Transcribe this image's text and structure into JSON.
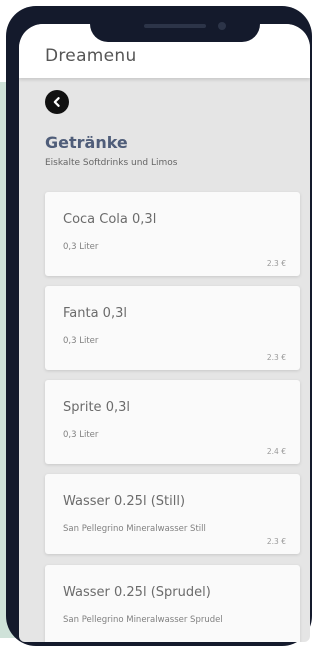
{
  "app": {
    "title": "Dreamenu"
  },
  "category": {
    "title": "Getränke",
    "subtitle": "Eiskalte Softdrinks und Limos"
  },
  "items": [
    {
      "name": "Coca Cola 0,3l",
      "description": "0,3 Liter",
      "price": "2.3 €"
    },
    {
      "name": "Fanta 0,3l",
      "description": "0,3 Liter",
      "price": "2.3 €"
    },
    {
      "name": "Sprite 0,3l",
      "description": "0,3 Liter",
      "price": "2.4 €"
    },
    {
      "name": "Wasser 0.25l (Still)",
      "description": "San Pellegrino Mineralwasser Still",
      "price": "2.3 €"
    },
    {
      "name": "Wasser 0.25l (Sprudel)",
      "description": "San Pellegrino Mineralwasser Sprudel",
      "price": ""
    }
  ],
  "icons": {
    "back": "back-arrow-icon"
  },
  "colors": {
    "header_bg": "#ffffff",
    "screen_bg": "#e5e5e5",
    "card_bg": "#fafafa",
    "category_title": "#4f5d79",
    "phone_frame": "#141a2c",
    "mint_backdrop": "#cfe2d9"
  }
}
